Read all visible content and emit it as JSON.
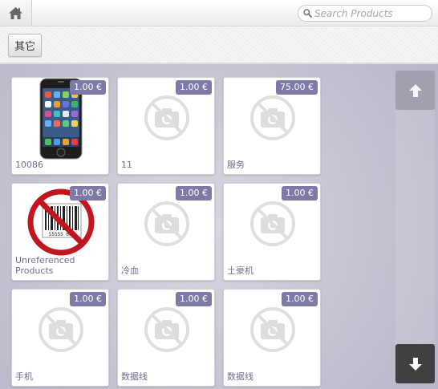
{
  "header": {
    "home_icon": "home-icon",
    "search_placeholder": "Search Products",
    "search_icon": "search-icon"
  },
  "categories": [
    {
      "label": "其它"
    }
  ],
  "products": [
    {
      "name": "10086",
      "price": "1.00 €",
      "image": "phone"
    },
    {
      "name": "11",
      "price": "1.00 €",
      "image": "no-photo"
    },
    {
      "name": "服务",
      "price": "75.00 €",
      "image": "no-photo"
    },
    {
      "name": "Unreferenced Products",
      "price": "1.00 €",
      "image": "unreferenced-barcode"
    },
    {
      "name": "冷血",
      "price": "1.00 €",
      "image": "no-photo"
    },
    {
      "name": "土豪机",
      "price": "1.00 €",
      "image": "no-photo"
    },
    {
      "name": "手机",
      "price": "1.00 €",
      "image": "no-photo"
    },
    {
      "name": "数据线",
      "price": "1.00 €",
      "image": "no-photo"
    },
    {
      "name": "数据线",
      "price": "1.00 €",
      "image": "no-photo"
    }
  ],
  "scroll": {
    "up_icon": "arrow-up-icon",
    "down_icon": "arrow-down-icon"
  },
  "colors": {
    "price_badge": "#7d7ba6",
    "product_name": "#6e6e8c",
    "scroll_down": "#404040",
    "scroll_up": "#a3a0ad"
  },
  "barcode_text": "55555 666"
}
